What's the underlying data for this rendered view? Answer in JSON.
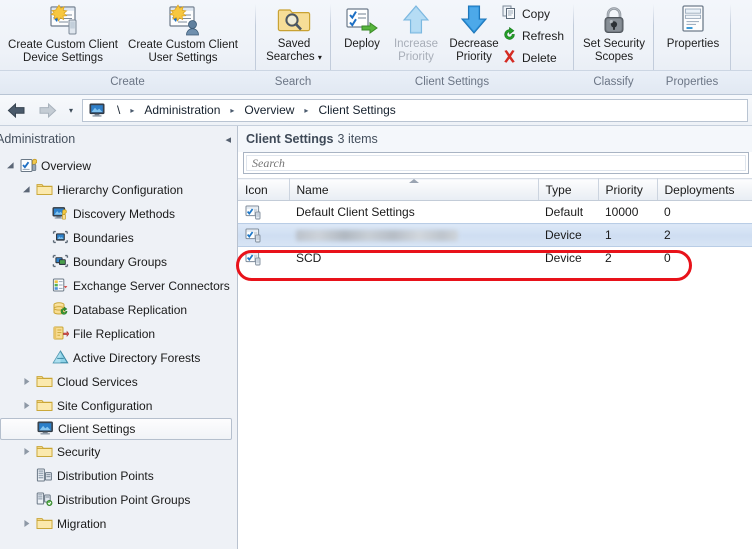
{
  "ribbon": {
    "groups": [
      {
        "label": "Create"
      },
      {
        "label": "Search"
      },
      {
        "label": "Client Settings"
      },
      {
        "label": "Classify"
      },
      {
        "label": "Properties"
      }
    ],
    "buttons": {
      "create_device": "Create Custom Client\nDevice Settings",
      "create_device_l1": "Create Custom Client",
      "create_device_l2": "Device Settings",
      "create_user_l1": "Create Custom Client",
      "create_user_l2": "User Settings",
      "saved_searches_l1": "Saved",
      "saved_searches_l2": "Searches",
      "deploy": "Deploy",
      "increase_l1": "Increase",
      "increase_l2": "Priority",
      "decrease_l1": "Decrease",
      "decrease_l2": "Priority",
      "copy": "Copy",
      "refresh": "Refresh",
      "delete": "Delete",
      "security_l1": "Set Security",
      "security_l2": "Scopes",
      "properties": "Properties"
    }
  },
  "nav": {
    "back_icon": "arrow-left-icon",
    "forward_icon": "arrow-right-icon",
    "dropdown_icon": "chevron-down-icon",
    "root_icon": "monitor-icon",
    "crumbs": [
      "\\",
      "Administration",
      "Overview",
      "Client Settings"
    ],
    "separator": "▸"
  },
  "sidebar": {
    "title": "Administration",
    "collapse_icon": "chevron-left-icon",
    "items": [
      {
        "label": "Overview",
        "indent": 0,
        "twisty": "open",
        "icon": "overview-icon",
        "selected": false
      },
      {
        "label": "Hierarchy Configuration",
        "indent": 1,
        "twisty": "open",
        "icon": "folder-icon",
        "selected": false
      },
      {
        "label": "Discovery Methods",
        "indent": 2,
        "twisty": "none",
        "icon": "discovery-icon",
        "selected": false
      },
      {
        "label": "Boundaries",
        "indent": 2,
        "twisty": "none",
        "icon": "boundary-icon",
        "selected": false
      },
      {
        "label": "Boundary Groups",
        "indent": 2,
        "twisty": "none",
        "icon": "boundary-group-icon",
        "selected": false
      },
      {
        "label": "Exchange Server Connectors",
        "indent": 2,
        "twisty": "none",
        "icon": "exchange-icon",
        "selected": false
      },
      {
        "label": "Database Replication",
        "indent": 2,
        "twisty": "none",
        "icon": "database-replication-icon",
        "selected": false
      },
      {
        "label": "File Replication",
        "indent": 2,
        "twisty": "none",
        "icon": "file-replication-icon",
        "selected": false
      },
      {
        "label": "Active Directory Forests",
        "indent": 2,
        "twisty": "none",
        "icon": "active-directory-icon",
        "selected": false
      },
      {
        "label": "Cloud Services",
        "indent": 1,
        "twisty": "closed",
        "icon": "folder-icon",
        "selected": false
      },
      {
        "label": "Site Configuration",
        "indent": 1,
        "twisty": "closed",
        "icon": "folder-icon",
        "selected": false
      },
      {
        "label": "Client Settings",
        "indent": 1,
        "twisty": "none",
        "icon": "monitor-icon",
        "selected": true
      },
      {
        "label": "Security",
        "indent": 1,
        "twisty": "closed",
        "icon": "folder-icon",
        "selected": false
      },
      {
        "label": "Distribution Points",
        "indent": 1,
        "twisty": "none",
        "icon": "distribution-point-icon",
        "selected": false
      },
      {
        "label": "Distribution Point Groups",
        "indent": 1,
        "twisty": "none",
        "icon": "distribution-point-group-icon",
        "selected": false
      },
      {
        "label": "Migration",
        "indent": 1,
        "twisty": "closed",
        "icon": "folder-icon",
        "selected": false
      }
    ]
  },
  "main": {
    "title": "Client Settings",
    "count_text": "3 items",
    "search": {
      "placeholder": "Search",
      "value": ""
    },
    "columns": [
      "Icon",
      "Name",
      "Type",
      "Priority",
      "Deployments"
    ],
    "sorted_column": "Name",
    "sort_direction": "asc",
    "rows": [
      {
        "name": "Default Client Settings",
        "type": "Default",
        "priority": "10000",
        "deployments": "0",
        "selected": false,
        "redacted": false,
        "annotated": false
      },
      {
        "name": "",
        "type": "Device",
        "priority": "1",
        "deployments": "2",
        "selected": true,
        "redacted": true,
        "annotated": false
      },
      {
        "name": "SCD",
        "type": "Device",
        "priority": "2",
        "deployments": "0",
        "selected": false,
        "redacted": false,
        "annotated": true
      }
    ]
  },
  "annotation": {
    "color": "#e8121a",
    "target_row": "SCD",
    "shape": "rounded-rectangle"
  }
}
